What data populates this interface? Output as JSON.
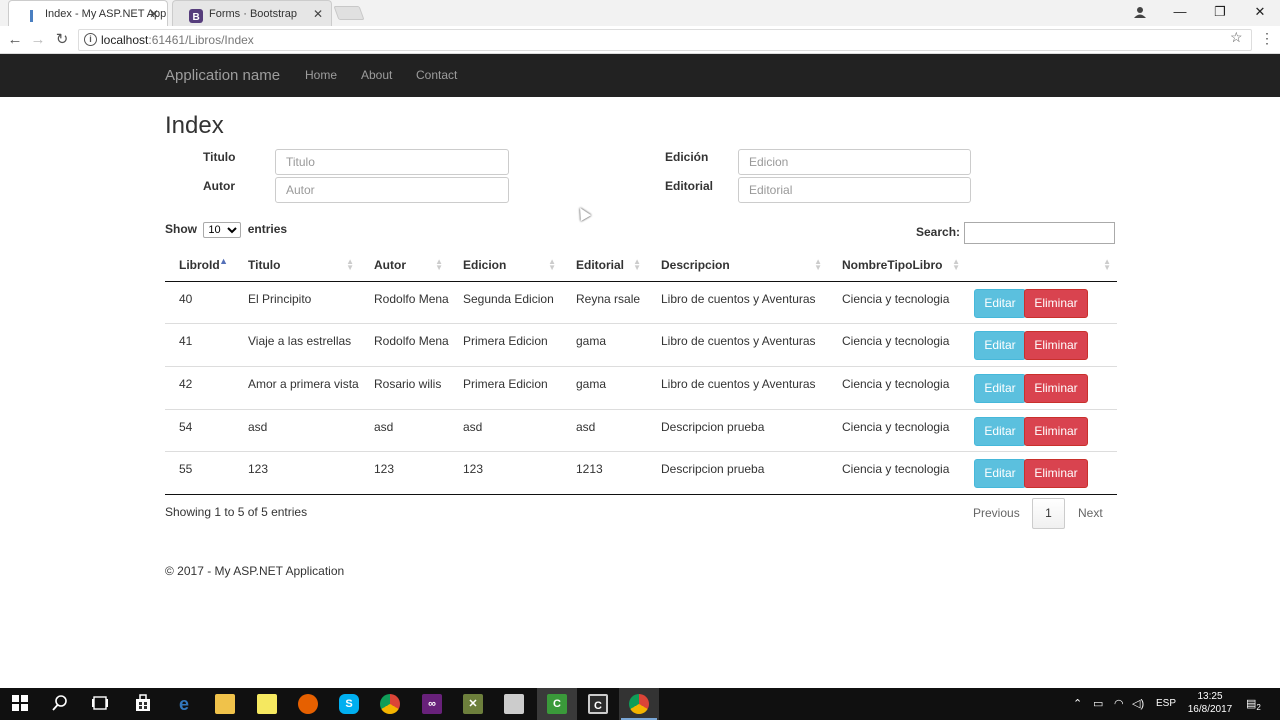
{
  "browser": {
    "tabs": [
      {
        "title": "Index - My ASP.NET App"
      },
      {
        "title": "Forms · Bootstrap"
      }
    ],
    "url_host": "localhost",
    "url_path": ":61461/Libros/Index"
  },
  "navbar": {
    "brand": "Application name",
    "links": [
      "Home",
      "About",
      "Contact"
    ]
  },
  "page_title": "Index",
  "filters": {
    "titulo_label": "Titulo",
    "titulo_placeholder": "Titulo",
    "autor_label": "Autor",
    "autor_placeholder": "Autor",
    "edicion_label": "Edición",
    "edicion_placeholder": "Edicion",
    "editorial_label": "Editorial",
    "editorial_placeholder": "Editorial"
  },
  "datatable": {
    "show_label": "Show",
    "entries_label": "entries",
    "page_length": "10",
    "search_label": "Search:",
    "columns": [
      "LibroId",
      "Titulo",
      "Autor",
      "Edicion",
      "Editorial",
      "Descripcion",
      "NombreTipoLibro",
      ""
    ],
    "rows": [
      [
        "40",
        "El Principito",
        "Rodolfo Mena",
        "Segunda Edicion",
        "Reyna rsale",
        "Libro de cuentos y Aventuras",
        "Ciencia y tecnologia"
      ],
      [
        "41",
        "Viaje a las estrellas",
        "Rodolfo Mena",
        "Primera Edicion",
        "gama",
        "Libro de cuentos y Aventuras",
        "Ciencia y tecnologia"
      ],
      [
        "42",
        "Amor a primera vista",
        "Rosario wilis",
        "Primera Edicion",
        "gama",
        "Libro de cuentos y Aventuras",
        "Ciencia y tecnologia"
      ],
      [
        "54",
        "asd",
        "asd",
        "asd",
        "asd",
        "Descripcion prueba",
        "Ciencia y tecnologia"
      ],
      [
        "55",
        "123",
        "123",
        "123",
        "1213",
        "Descripcion prueba",
        "Ciencia y tecnologia"
      ]
    ],
    "edit_label": "Editar",
    "delete_label": "Eliminar",
    "info": "Showing 1 to 5 of 5 entries",
    "prev_label": "Previous",
    "current_page": "1",
    "next_label": "Next"
  },
  "footer": "© 2017 - My ASP.NET Application",
  "taskbar": {
    "language": "ESP",
    "time": "13:25",
    "date": "16/8/2017",
    "notifications": "2"
  },
  "colors": {
    "navbar_bg": "#222222",
    "edit_btn": "#5bc0de",
    "delete_btn": "#d9434f",
    "sort_active": "#5470b8"
  }
}
